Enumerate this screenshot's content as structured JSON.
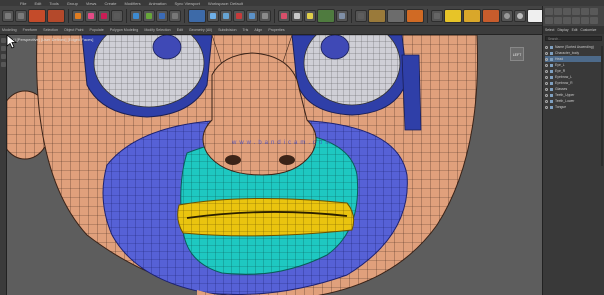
{
  "menubar": {
    "items": [
      "File",
      "Edit",
      "Tools",
      "Group",
      "Views",
      "Create",
      "Modifiers",
      "Animation"
    ]
  },
  "toolbar": {
    "workspace_label": "Sync Viewport",
    "mode_label": "Workspace: Default"
  },
  "toolbar2": {
    "items": [
      "Modeling",
      "Freeform",
      "Selection",
      "Object Paint",
      "Populate",
      "Polygon Modeling",
      "Modify Selection",
      "Edit",
      "Geometry (All)",
      "Subdivision",
      "Tris",
      "Align",
      "Properties"
    ]
  },
  "viewport": {
    "label": "[+] [Perspective] [User Defined] [Edged Faces]",
    "nav_cube": "LEFT",
    "watermark": "www.bandicam.com",
    "colors": {
      "background": "#5d5d5d",
      "skin": "#e2a27e",
      "blue_region": "#5460d8",
      "cyan_region": "#1bc7c2",
      "yellow_region": "#e9c20f"
    }
  },
  "right_panel": {
    "tabs": [
      "Select",
      "Display",
      "Edit",
      "Customize"
    ],
    "search_placeholder": "Search...",
    "tree": [
      {
        "label": "Name (Sorted Ascending)",
        "selected": false
      },
      {
        "label": "Character_body",
        "selected": false
      },
      {
        "label": "Head",
        "selected": true
      },
      {
        "label": "Eye_L",
        "selected": false
      },
      {
        "label": "Eye_R",
        "selected": false
      },
      {
        "label": "Eyebrow_L",
        "selected": false
      },
      {
        "label": "Eyebrow_R",
        "selected": false
      },
      {
        "label": "Glasses",
        "selected": false
      },
      {
        "label": "Teeth_Upper",
        "selected": false
      },
      {
        "label": "Teeth_Lower",
        "selected": false
      },
      {
        "label": "Tongue",
        "selected": false
      }
    ]
  }
}
